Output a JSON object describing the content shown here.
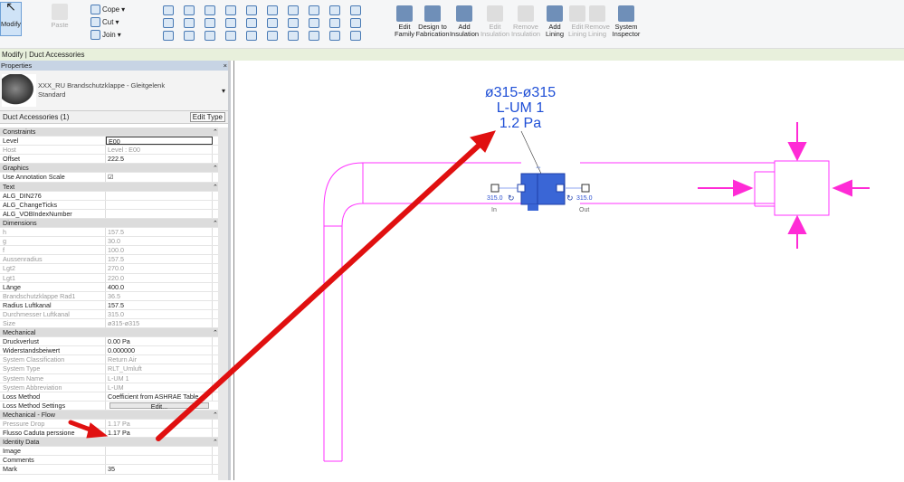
{
  "ribbon": {
    "modify": "Modify",
    "paste": "Paste",
    "cope": "Cope",
    "cut": "Cut",
    "join": "Join",
    "buttons": [
      {
        "label": "Edit Family",
        "enabled": true
      },
      {
        "label": "Design to Fabrication",
        "enabled": true
      },
      {
        "label": "Add Insulation",
        "enabled": true
      },
      {
        "label": "Edit Insulation",
        "enabled": false
      },
      {
        "label": "Remove Insulation",
        "enabled": false
      },
      {
        "label": "Add Lining",
        "enabled": true
      },
      {
        "label": "Edit Lining",
        "enabled": false
      },
      {
        "label": "Remove Lining",
        "enabled": false
      },
      {
        "label": "System Inspector",
        "enabled": true
      }
    ]
  },
  "context": "Modify | Duct Accessories",
  "properties": {
    "title": "Properties",
    "close": "×",
    "type_name": "XXX_RU Brandschutzklappe - Gleitgelenk",
    "type_sub": "Standard",
    "instance": "Duct Accessories (1)",
    "edit_type": "Edit Type",
    "rows": [
      {
        "h": "Constraints"
      },
      {
        "k": "Level",
        "v": "E00"
      },
      {
        "k": "Host",
        "v": "Level : E00",
        "dim": true
      },
      {
        "k": "Offset",
        "v": "222.5"
      },
      {
        "h": "Graphics"
      },
      {
        "k": "Use Annotation Scale",
        "v": "☑"
      },
      {
        "h": "Text"
      },
      {
        "k": "ALG_DIN276",
        "v": ""
      },
      {
        "k": "ALG_ChangeTicks",
        "v": ""
      },
      {
        "k": "ALG_VOBIndexNumber",
        "v": ""
      },
      {
        "h": "Dimensions"
      },
      {
        "k": "h",
        "v": "157.5",
        "dim": true
      },
      {
        "k": "g",
        "v": "30.0",
        "dim": true
      },
      {
        "k": "f",
        "v": "100.0",
        "dim": true
      },
      {
        "k": "Aussenradius",
        "v": "157.5",
        "dim": true
      },
      {
        "k": "Lgt2",
        "v": "270.0",
        "dim": true
      },
      {
        "k": "Lgt1",
        "v": "220.0",
        "dim": true
      },
      {
        "k": "Länge",
        "v": "400.0"
      },
      {
        "k": "Brandschutzklappe Rad1",
        "v": "36.5",
        "dim": true
      },
      {
        "k": "Radius Luftkanal",
        "v": "157.5"
      },
      {
        "k": "Durchmesser Luftkanal",
        "v": "315.0",
        "dim": true
      },
      {
        "k": "Size",
        "v": "ø315-ø315",
        "dim": true
      },
      {
        "h": "Mechanical"
      },
      {
        "k": "Druckverlust",
        "v": "0.00 Pa"
      },
      {
        "k": "Widerstandsbeiwert",
        "v": "0.000000"
      },
      {
        "k": "System Classification",
        "v": "Return Air",
        "dim": true
      },
      {
        "k": "System Type",
        "v": "RLT_Umluft",
        "dim": true
      },
      {
        "k": "System Name",
        "v": "L-UM 1",
        "dim": true
      },
      {
        "k": "System Abbreviation",
        "v": "L-UM",
        "dim": true
      },
      {
        "k": "Loss Method",
        "v": "Coefficient from ASHRAE Table"
      },
      {
        "k": "Loss Method Settings",
        "btn": "Edit..."
      },
      {
        "h": "Mechanical - Flow"
      },
      {
        "k": "Pressure Drop",
        "v": "1.17 Pa",
        "dim": true
      },
      {
        "k": "Flusso Caduta perssione",
        "v": "1.17 Pa"
      },
      {
        "h": "Identity Data"
      },
      {
        "k": "Image",
        "v": ""
      },
      {
        "k": "Comments",
        "v": ""
      },
      {
        "k": "Mark",
        "v": "35"
      }
    ]
  },
  "drawing": {
    "tag_size": "ø315-ø315",
    "tag_system": "L-UM 1",
    "tag_pressure": "1.2 Pa",
    "in_dim": "315.0",
    "out_dim": "315.0",
    "in_label": "In",
    "out_label": "Out",
    "colors": {
      "duct": "#ff33ff",
      "accessory": "#3a66d6",
      "arrow": "#e01010",
      "tag": "#1f4fd6"
    }
  }
}
